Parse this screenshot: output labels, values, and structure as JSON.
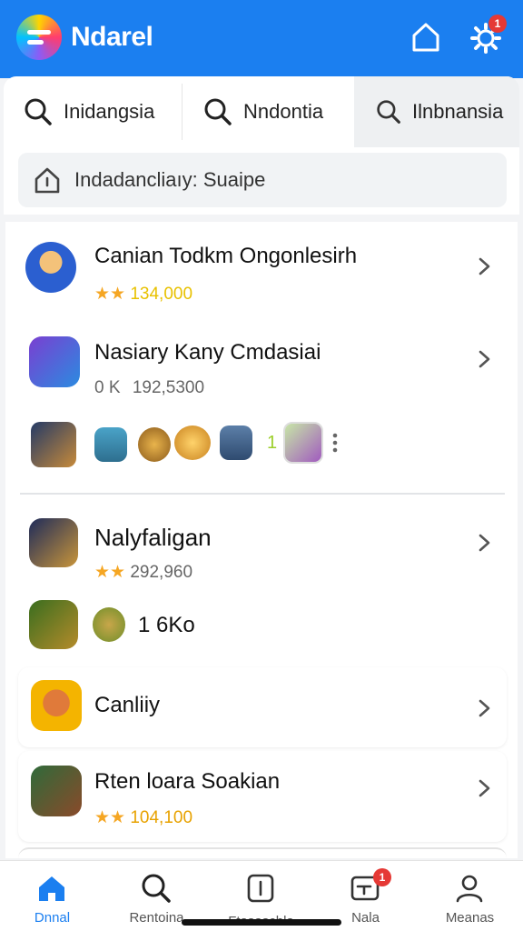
{
  "header": {
    "title": "Ndarel",
    "notification_count": "1",
    "brand_color": "#1b7ff0"
  },
  "search_tabs": [
    {
      "label": "Inidangsia",
      "icon": "search-icon"
    },
    {
      "label": "Nndontia",
      "icon": "search-icon"
    },
    {
      "label": "Ilnbnansia",
      "icon": "search-icon"
    }
  ],
  "breadcrumb": {
    "text": "Indadancliaıy: Suaipe",
    "icon": "home-icon"
  },
  "apps": [
    {
      "name": "Canian Todkm Ongonlesirh",
      "rating_text": "134,000",
      "stars": 2,
      "rating_color": "#e8c100"
    },
    {
      "name": "Nasiary Kany Cmdasiai",
      "prefix": "0 K",
      "rating_text": "192,5300",
      "rating_color": "#666666"
    },
    {
      "name": "Nalyfaligan",
      "rating_text": "292,960",
      "stars": 2,
      "rating_color": "#666666"
    },
    {
      "name": "Canliiy"
    },
    {
      "name": "Rten loara Soakian",
      "rating_text": "104,100",
      "stars": 2,
      "rating_color": "#e8a200"
    }
  ],
  "extras": {
    "mini_row_marker": "1",
    "sub_row_text": "1 6Ko"
  },
  "bottom_nav": [
    {
      "label": "Dnnal",
      "icon": "home-icon",
      "active": true
    },
    {
      "label": "Rentoina",
      "icon": "search-icon"
    },
    {
      "label": "Ftasaschla",
      "icon": "info-icon"
    },
    {
      "label": "Nala",
      "icon": "message-icon",
      "badge": "1"
    },
    {
      "label": "Meanas",
      "icon": "person-icon"
    }
  ],
  "colors": {
    "accent": "#1b7ff0",
    "star_orange": "#f5a623",
    "badge_red": "#e53935"
  }
}
